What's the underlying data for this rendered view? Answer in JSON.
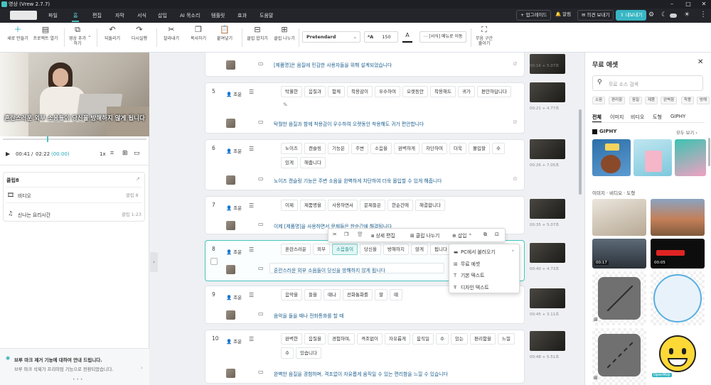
{
  "window": {
    "title": "영상 (Vrew 2.7.7)"
  },
  "menu": {
    "items": [
      "파일",
      "홈",
      "편집",
      "자막",
      "서식",
      "삽입",
      "AI 목소리",
      "템플릿",
      "효과",
      "도움말"
    ],
    "active": "홈"
  },
  "top_buttons": {
    "upgrade": "업그레이드",
    "alert": "알림",
    "feedback": "의견 보내기",
    "export": "내보내기"
  },
  "toolbar": {
    "new_project": "새로 만들기",
    "open_project": "프로젝트 열기",
    "add_video": "영상 추가하기",
    "undo": "되돌리기",
    "redo": "다시실행",
    "cut": "잘라내기",
    "copy": "복사하기",
    "paste": "붙여넣기",
    "merge_clip": "클립 합치기",
    "split_clip": "클립 나누기",
    "font": "Pretendard",
    "font_size": "150",
    "format_menu": "[서식] 메뉴로 이동",
    "silence": "무음 구간 줄이기"
  },
  "player": {
    "subtitle": "혼란스러운 외부 소음들이 당신을 방해하지 않게 됩니다",
    "current_time": "00:41",
    "total_time": "02:22",
    "offset": "(00:00)",
    "speed": "1x"
  },
  "clip_panel": {
    "title": "클립8",
    "rows": [
      {
        "label": "비디오",
        "meta": "클립 8"
      },
      {
        "label": "신나는 요리시간",
        "meta": "클립 1-23"
      }
    ]
  },
  "notice": {
    "title": "브루 마크 제거 기능에 대하여 안내 드립니다.",
    "body": "브루 마크 삭제가 프리미엄 기능으로 전환되었습니다."
  },
  "clips": [
    {
      "num": "",
      "speaker": "",
      "words": [],
      "subtitle": "[제품명]은 음질에 민감한 사용자들을 위해 설계되었습니다",
      "time": "00:16 + 5.07초"
    },
    {
      "num": "5",
      "speaker": "조운",
      "words": [
        "탁월한",
        "음질과",
        "함께",
        "착용감이",
        "우수하여",
        "오랫동안",
        "착용해도",
        "귀가",
        "편안하답니다"
      ],
      "subtitle": "탁월한 음질과 함께 착용감이 우수하여 오랫동안 착용해도 귀가 편안합니다",
      "time": "00:21 + 4.77초"
    },
    {
      "num": "6",
      "speaker": "조운",
      "words": [
        "노이즈",
        "캔슬링",
        "기능은",
        "주변",
        "소음을",
        "완벽하게",
        "차단하여",
        "더욱",
        "몰입할",
        "수",
        "있게",
        "해줍니다"
      ],
      "subtitle": "노이즈 캔슬링 기능은 주변 소음을 완벽하게 차단하여 더욱 몰입할 수 있게 해줍니다",
      "time": "00:26 + 7.05초"
    },
    {
      "num": "7",
      "speaker": "조운",
      "words": [
        "이제",
        "제품명을",
        "사용하면서",
        "문제들은",
        "한순간에",
        "해결합니다"
      ],
      "subtitle": "이제 [제품명]을 사용하면서 문제들은 한순간에 해결됩니다",
      "time": "00:35 + 5.07초"
    },
    {
      "num": "8",
      "speaker": "조운",
      "words": [
        "혼란스러운",
        "외부",
        "소음들이",
        "당신을",
        "방해하지",
        "않게",
        "됩니다"
      ],
      "subtitle": "혼란스러운 외부 소음들이 당신을 방해하지 않게 됩니다",
      "time": "00:40 + 4.73초"
    },
    {
      "num": "9",
      "speaker": "조운",
      "words": [
        "음악을",
        "들을",
        "때나",
        "전화통화를",
        "할",
        "때"
      ],
      "subtitle": "음악을 들을 때나 전화통화를 할 때",
      "time": "00:45 + 3.11초"
    },
    {
      "num": "10",
      "speaker": "조운",
      "words": [
        "완벽한",
        "음질을",
        "경험하며,",
        "격조없이",
        "자유롭게",
        "움직일",
        "수",
        "있는",
        "편리함을",
        "느낄",
        "수",
        "있습니다"
      ],
      "subtitle": "완벽한 음질을 경험하며, 격조없이 자유롭게 움직일 수 있는 편리함을 느낄 수 있습니다",
      "time": "00:48 + 5.51초"
    }
  ],
  "floatbar": {
    "detail_edit": "상세 편집",
    "split": "클립 나누기",
    "insert": "삽입"
  },
  "dropdown": {
    "items": [
      "PC에서 불러오기",
      "무료 에셋",
      "기본 텍스트",
      "디자인 텍스트"
    ]
  },
  "assets": {
    "title": "무료 애셋",
    "search_placeholder": "무료 소스 검색",
    "chips": [
      "소음",
      "편리함",
      "음질",
      "제품",
      "완벽함",
      "착용",
      "방해"
    ],
    "tabs": [
      "전체",
      "이미지",
      "비디오",
      "도형",
      "GIPHY"
    ],
    "active_tab": "전체",
    "giphy_title": "GIPHY",
    "see_all": "모두 보기",
    "section2": "이미지 · 비디오 · 도형",
    "video_badges": [
      "00:17",
      "00:05"
    ],
    "sticker_badge": "OpenMoji"
  }
}
